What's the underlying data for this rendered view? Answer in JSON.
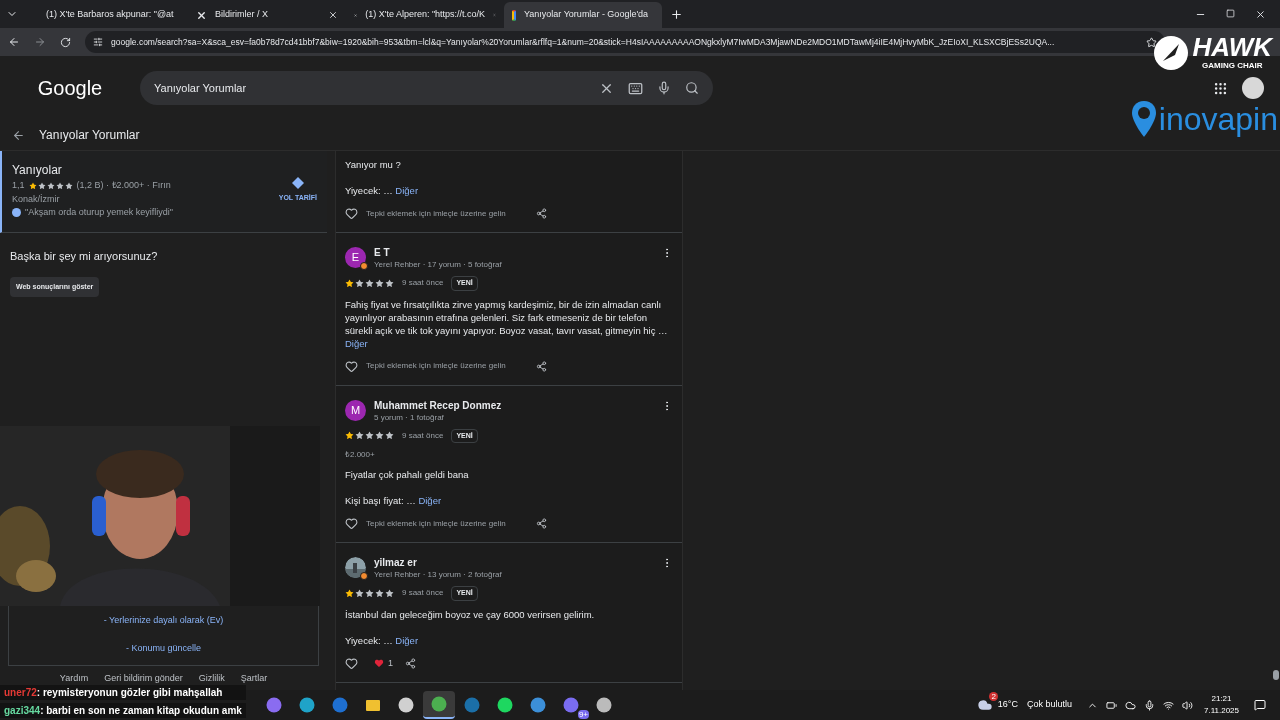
{
  "tabs": [
    {
      "title": "(1) X'te Barbaros akpunar: \"@at",
      "kind": "x",
      "selected": false
    },
    {
      "title": "Bildirimler / X",
      "kind": "x",
      "selected": false
    },
    {
      "title": "(1) X'te Alperen: \"https://t.co/K",
      "kind": "x",
      "selected": false
    },
    {
      "title": "Yanıyolar Yorumlar - Google'da",
      "kind": "google",
      "selected": true
    }
  ],
  "address": "google.com/search?sa=X&sca_esv=fa0b78d7cd41bbf7&biw=1920&bih=953&tbm=lcl&q=Yanıyolar%20Yorumlar&rflfq=1&num=20&stick=H4sIAAAAAAAAAONgkxlyM7IwMDA3MjawNDe2MDO1MDTawMj4iIE4MjHvyMbK_JzEIoXI_KLSXCBjESs2UQA...",
  "overlay": {
    "brand": "HAWK",
    "tagline": "GAMING CHAIR",
    "sponsor": "inovapin"
  },
  "google": {
    "logo": "Google",
    "query": "Yanıyolar Yorumlar"
  },
  "back_title": "Yanıyolar Yorumlar",
  "place": {
    "name": "Yanıyolar",
    "rating": "1,1",
    "stars": 1,
    "details": "(1,2 B) · ₺2.000+ · Fırın",
    "location": "Konak/İzmir",
    "quote": "\"Akşam orda oturup yemek keyifliydi\"",
    "directions": "YOL TARİFİ"
  },
  "suggest": {
    "question": "Başka bir şey mi arıyorsunuz?",
    "button": "Web sonuçlarını göster"
  },
  "location_links": [
    "- Yerlerinize dayalı olarak (Ev)",
    "- Konumu güncelle"
  ],
  "footer": [
    "Yardım",
    "Geri bildirim gönder",
    "Gizlilik",
    "Şartlar"
  ],
  "reviews": [
    {
      "kind": "partial",
      "paragraphs": [
        "Yanıyor mu ?"
      ],
      "more_prefix": "Yiyecek: …",
      "more_link": "Diğer",
      "reaction": {
        "kind": "hint",
        "text": "Tepki eklemek için imleçle üzerine gelin"
      }
    },
    {
      "kind": "full",
      "author": "E T",
      "avatar": {
        "kind": "letter",
        "letter": "E",
        "color": "#9c27b0"
      },
      "local_guide": true,
      "meta": "Yerel Rehber · 17 yorum · 5 fotoğraf",
      "stars": 1,
      "time": "9 saat önce",
      "badge": "YENİ",
      "text": "Fahiş fiyat ve fırsatçılıkta zirve yapmış kardeşimiz, bir de izin almadan canlı yayınlıyor arabasının etrafına gelenleri. Siz fark etmeseniz de bir telefon sürekli açık ve tik tok yayını yapıyor. Boyoz vasat, tavır vasat, gitmeyin hiç …",
      "inline_link": "Diğer",
      "reaction": {
        "kind": "hint",
        "text": "Tepki eklemek için imleçle üzerine gelin"
      }
    },
    {
      "kind": "full",
      "author": "Muhammet Recep Donmez",
      "avatar": {
        "kind": "letter",
        "letter": "M",
        "color": "#9c27b0"
      },
      "local_guide": false,
      "meta": "5 yorum · 1 fotoğraf",
      "stars": 1,
      "time": "9 saat önce",
      "badge": "YENİ",
      "price": "₺2.000+",
      "paragraphs": [
        "Fiyatlar çok pahalı geldi bana"
      ],
      "more_prefix": "Kişi başı fiyat: …",
      "more_link": "Diğer",
      "reaction": {
        "kind": "hint",
        "text": "Tepki eklemek için imleçle üzerine gelin"
      }
    },
    {
      "kind": "full",
      "author": "yilmaz er",
      "avatar": {
        "kind": "picture"
      },
      "local_guide": true,
      "meta": "Yerel Rehber · 13 yorum · 2 fotoğraf",
      "stars": 1,
      "time": "9 saat önce",
      "badge": "YENİ",
      "paragraphs": [
        "İstanbul dan geleceğim boyoz ve çay 6000 verirsen gelirim."
      ],
      "more_prefix": "Yiyecek: …",
      "more_link": "Diğer",
      "reaction": {
        "kind": "count",
        "text": "1"
      }
    }
  ],
  "chat": [
    {
      "user": "uner72",
      "color": "#e53935",
      "message": ": reymisteryonun gözler gibi mahşallah"
    },
    {
      "user": "gazi344",
      "color": "#66d9a0",
      "message": ": barbi en son ne zaman kitap okudun amk"
    }
  ],
  "taskbar": {
    "apps": [
      {
        "kind": "copilot",
        "selected": false
      },
      {
        "kind": "edge",
        "selected": false
      },
      {
        "kind": "mail",
        "selected": false
      },
      {
        "kind": "folder",
        "selected": false
      },
      {
        "kind": "xbox",
        "selected": false
      },
      {
        "kind": "chrome",
        "selected": true
      },
      {
        "kind": "steam",
        "selected": false
      },
      {
        "kind": "spotify",
        "selected": false
      },
      {
        "kind": "puzzle",
        "selected": false
      },
      {
        "kind": "discord",
        "selected": false,
        "badge": "9+"
      },
      {
        "kind": "obs",
        "selected": false
      }
    ],
    "weather_badge": "2",
    "temperature": "16°C",
    "weather": "Çok bulutlu",
    "time": "21:21",
    "date": "7.11.2025"
  }
}
